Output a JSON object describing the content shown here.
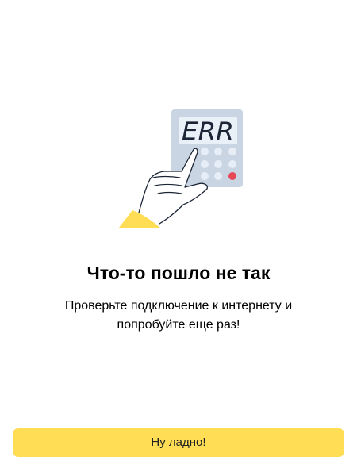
{
  "error": {
    "title": "Что-то пошло не так",
    "message": "Проверьте подключение к интернету и попробуйте еще раз!",
    "display_text": "ERR"
  },
  "actions": {
    "ok_label": "Ну ладно!"
  },
  "illustration": {
    "icon": "calculator-error-icon",
    "hand_icon": "pointing-hand-icon"
  },
  "colors": {
    "accent": "#ffdd55",
    "device_body": "#c9d5e3",
    "display_bg": "#e9f0f8",
    "key_light": "#e7eef7",
    "key_alert": "#e84855",
    "sleeve": "#ffdd55"
  }
}
